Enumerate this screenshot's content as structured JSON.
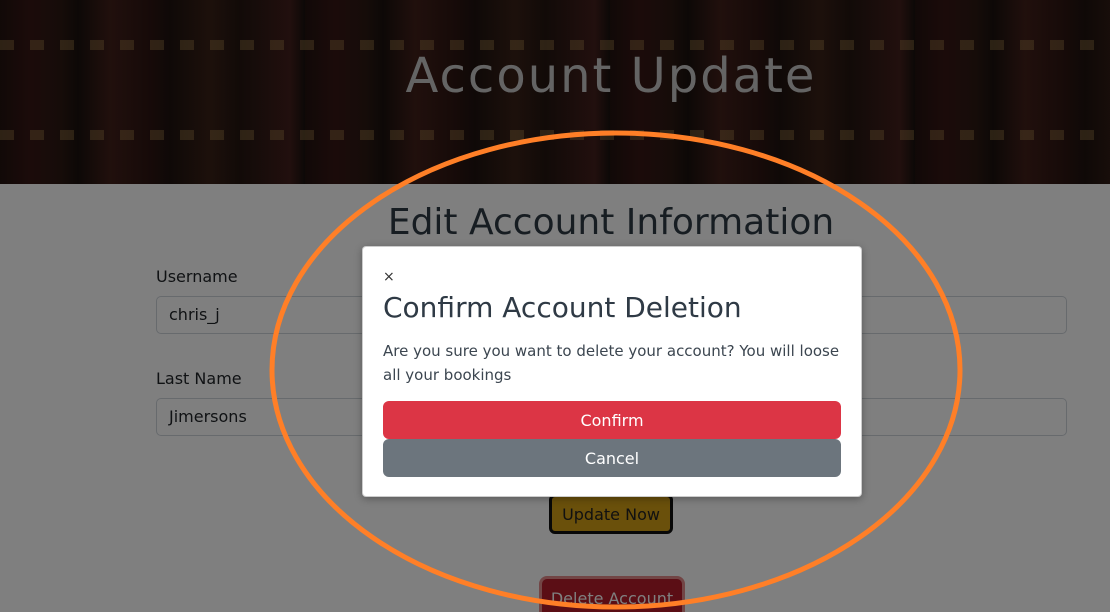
{
  "hero": {
    "title": "Account Update"
  },
  "form": {
    "heading": "Edit Account Information",
    "fields": [
      {
        "label": "Username",
        "value": "chris_j"
      },
      {
        "label": "Last Name",
        "value": "Jimersons"
      }
    ],
    "update_label": "Update Now",
    "delete_label": "Delete Account"
  },
  "modal": {
    "close_glyph": "×",
    "title": "Confirm Account Deletion",
    "body": "Are you sure you want to delete your account? You will loose all your bookings",
    "confirm_label": "Confirm",
    "cancel_label": "Cancel"
  },
  "colors": {
    "confirm": "#dc3545",
    "cancel": "#6c757d",
    "update": "#d4a017",
    "annotation": "#ff7f27"
  }
}
